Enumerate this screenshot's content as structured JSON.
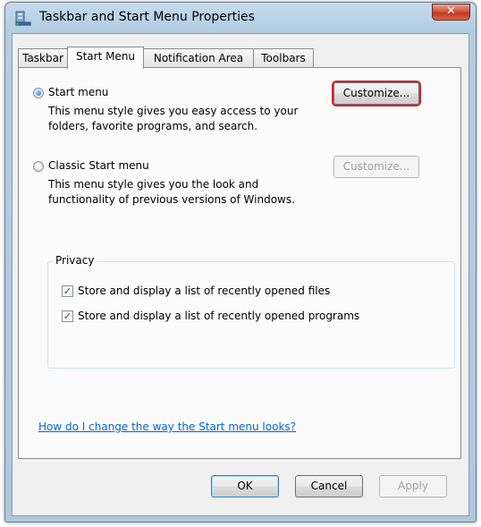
{
  "window": {
    "title": "Taskbar and Start Menu Properties",
    "close_glyph": "✕"
  },
  "tabs": [
    {
      "label": "Taskbar",
      "active": false
    },
    {
      "label": "Start Menu",
      "active": true
    },
    {
      "label": "Notification Area",
      "active": false
    },
    {
      "label": "Toolbars",
      "active": false
    }
  ],
  "start_menu": {
    "label": "Start menu",
    "selected": true,
    "description_line1": "This menu style gives you easy access to your",
    "description_line2": "folders, favorite programs, and search.",
    "customize_label": "Customize...",
    "customize_enabled": true
  },
  "classic_menu": {
    "label": "Classic Start menu",
    "selected": false,
    "description_line1": "This menu style gives you the look and",
    "description_line2": "functionality of previous versions of Windows.",
    "customize_label": "Customize...",
    "customize_enabled": false
  },
  "privacy": {
    "title": "Privacy",
    "options": [
      {
        "label": "Store and display a list of recently opened files",
        "checked": true
      },
      {
        "label": "Store and display a list of recently opened programs",
        "checked": true
      }
    ]
  },
  "help_link": "How do I change the way the Start menu looks?",
  "buttons": {
    "ok": "OK",
    "cancel": "Cancel",
    "apply": "Apply"
  },
  "colors": {
    "highlight_border": "#d8202c",
    "link": "#0066cc",
    "close_button": "#c13b24"
  }
}
